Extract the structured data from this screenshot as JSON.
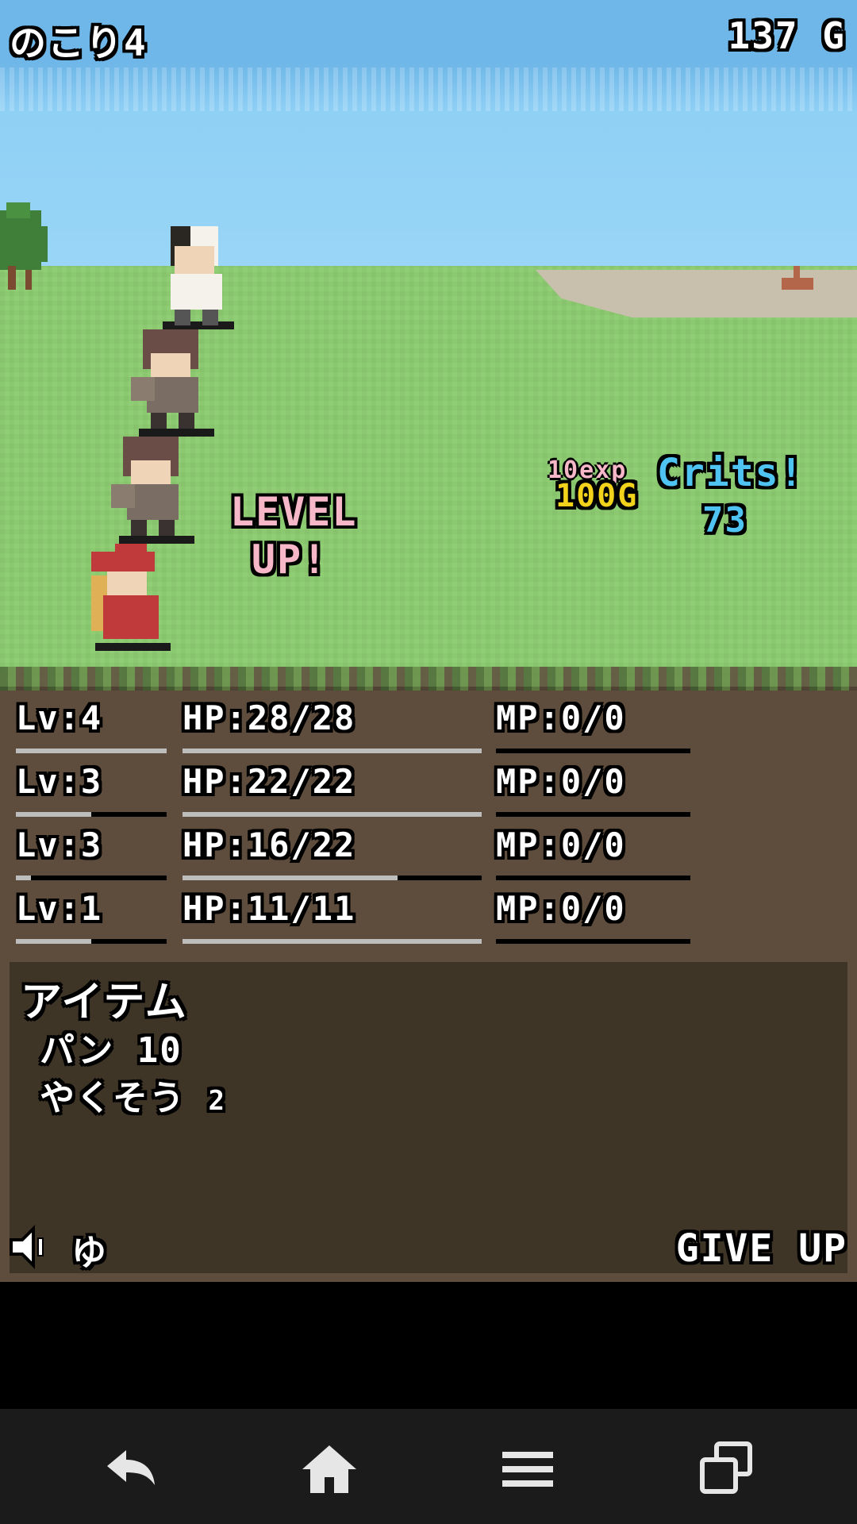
{
  "hud": {
    "title": "のこり4",
    "gold": "137 G"
  },
  "popups": {
    "level_up_line1": "LEVEL",
    "level_up_line2": "UP!",
    "exp": "10exp",
    "gold_gain": "100G",
    "crits": "Crits!",
    "crit_damage": "73"
  },
  "party": [
    {
      "lv": "Lv:4",
      "hp": "HP:28/28",
      "mp": "MP:0/0",
      "exp_fill": 1.0,
      "hp_fill": 1.0,
      "mp_fill": 0.0
    },
    {
      "lv": "Lv:3",
      "hp": "HP:22/22",
      "mp": "MP:0/0",
      "exp_fill": 0.5,
      "hp_fill": 1.0,
      "mp_fill": 0.0
    },
    {
      "lv": "Lv:3",
      "hp": "HP:16/22",
      "mp": "MP:0/0",
      "exp_fill": 0.1,
      "hp_fill": 0.72,
      "mp_fill": 0.0
    },
    {
      "lv": "Lv:1",
      "hp": "HP:11/11",
      "mp": "MP:0/0",
      "exp_fill": 0.5,
      "hp_fill": 1.0,
      "mp_fill": 0.0
    }
  ],
  "items": {
    "title": "アイテム",
    "list": [
      {
        "name": "パン",
        "count": "10"
      },
      {
        "name": "やくそう",
        "count": "2"
      }
    ]
  },
  "controls": {
    "sound_icon": "speaker-icon",
    "speed_label": "ゆ",
    "give_up": "GIVE UP"
  },
  "navbar": {
    "icons": [
      "back-icon",
      "home-icon",
      "menu-icon",
      "recent-apps-icon"
    ]
  }
}
